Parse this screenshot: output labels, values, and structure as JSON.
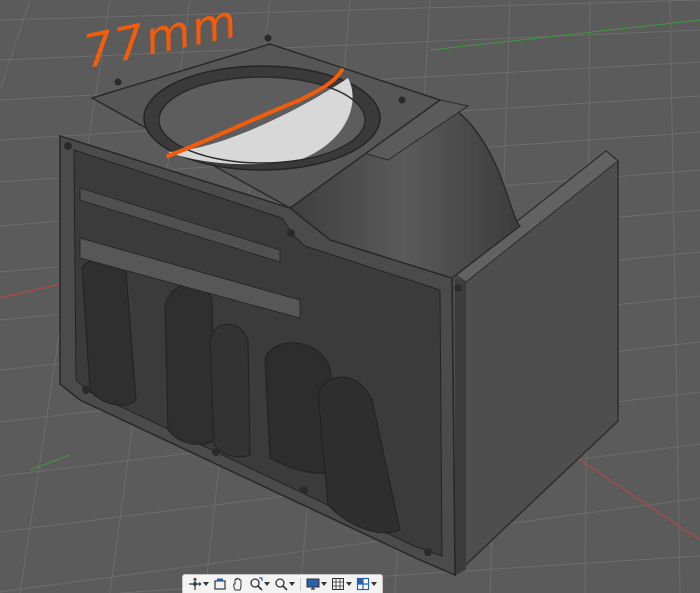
{
  "annotation": {
    "text": "77mm",
    "color": "#f25c0a"
  },
  "viewport": {
    "background_color": "#5a5a5a",
    "model_color": "#4a4a4a",
    "grid_color": "#6e6e6e",
    "axis_x_color": "#b84a4a",
    "axis_y_color": "#4aa24a"
  },
  "toolbar": {
    "items": [
      {
        "icon": "orbit-icon",
        "has_menu": true
      },
      {
        "icon": "look-at-icon",
        "has_menu": false
      },
      {
        "icon": "pan-hand-icon",
        "has_menu": false
      },
      {
        "icon": "zoom-icon",
        "has_menu": true
      },
      {
        "icon": "fit-icon",
        "has_menu": true
      },
      {
        "icon": "display-settings-icon",
        "has_menu": true
      },
      {
        "icon": "grid-settings-icon",
        "has_menu": true
      },
      {
        "icon": "viewports-icon",
        "has_menu": true
      }
    ]
  }
}
